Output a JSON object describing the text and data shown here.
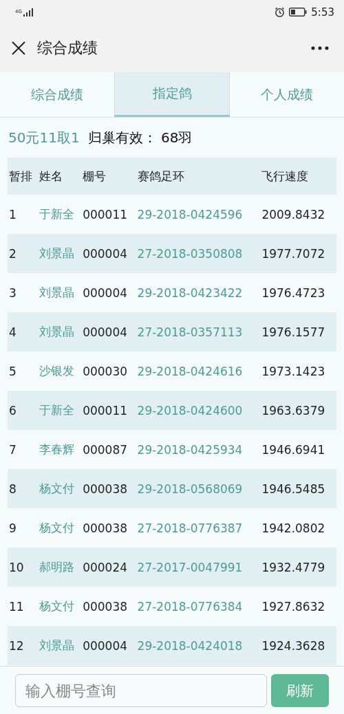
{
  "status_bar": {
    "network": "4G",
    "time": "5:53"
  },
  "app_bar": {
    "title": "综合成绩"
  },
  "tabs": [
    {
      "label": "综合成绩",
      "selected": false
    },
    {
      "label": "指定鸽",
      "selected": true
    },
    {
      "label": "个人成绩",
      "selected": false
    }
  ],
  "info": {
    "rule": "50元11取1",
    "summary": "归巢有效： 68羽"
  },
  "table": {
    "columns": [
      "暂排",
      "姓名",
      "棚号",
      "赛鸽足环",
      "飞行速度"
    ],
    "rows": [
      [
        "1",
        "于新全",
        "000011",
        "29-2018-0424596",
        "2009.8432"
      ],
      [
        "2",
        "刘景晶",
        "000004",
        "27-2018-0350808",
        "1977.7072"
      ],
      [
        "3",
        "刘景晶",
        "000004",
        "29-2018-0423422",
        "1976.4723"
      ],
      [
        "4",
        "刘景晶",
        "000004",
        "27-2018-0357113",
        "1976.1577"
      ],
      [
        "5",
        "沙银发",
        "000030",
        "29-2018-0424616",
        "1973.1423"
      ],
      [
        "6",
        "于新全",
        "000011",
        "29-2018-0424600",
        "1963.6379"
      ],
      [
        "7",
        "李春辉",
        "000087",
        "29-2018-0425934",
        "1946.6941"
      ],
      [
        "8",
        "杨文付",
        "000038",
        "29-2018-0568069",
        "1946.5485"
      ],
      [
        "9",
        "杨文付",
        "000038",
        "27-2018-0776387",
        "1942.0802"
      ],
      [
        "10",
        "郝明路",
        "000024",
        "27-2017-0047991",
        "1932.4779"
      ],
      [
        "11",
        "杨文付",
        "000038",
        "27-2018-0776384",
        "1927.8632"
      ],
      [
        "12",
        "刘景晶",
        "000004",
        "29-2018-0424018",
        "1924.3628"
      ]
    ]
  },
  "search": {
    "placeholder": "输入棚号查询",
    "button": "刷新"
  }
}
